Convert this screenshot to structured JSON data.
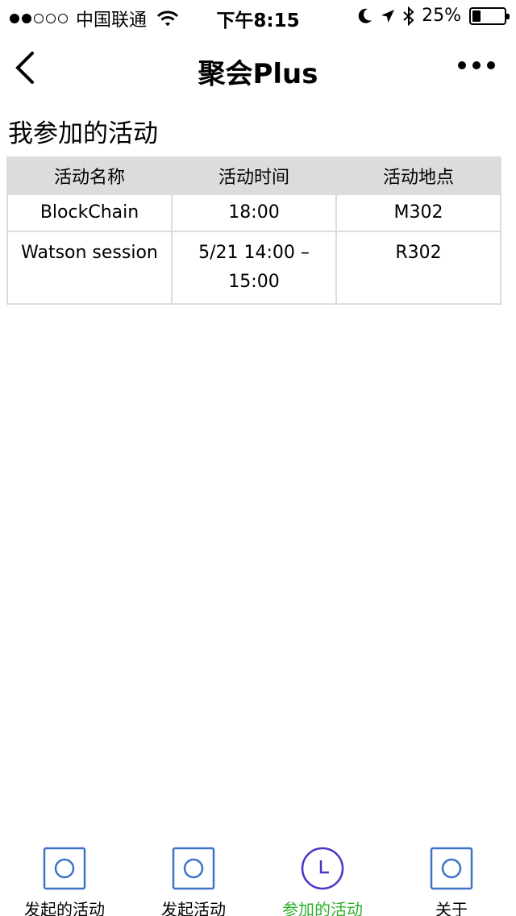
{
  "status_bar": {
    "carrier": "中国联通",
    "time": "下午8:15",
    "battery_percent": "25%",
    "battery_level": 0.25
  },
  "nav": {
    "title": "聚会Plus"
  },
  "page": {
    "section_title": "我参加的活动"
  },
  "table": {
    "headers": [
      "活动名称",
      "活动时间",
      "活动地点"
    ],
    "rows": [
      [
        "BlockChain",
        "18:00",
        "M302"
      ],
      [
        "Watson session",
        "5/21 14:00 – 15:00",
        "R302"
      ]
    ]
  },
  "tabs": [
    {
      "label": "发起的活动",
      "icon": "square-circle-icon",
      "active": false
    },
    {
      "label": "发起活动",
      "icon": "square-circle-icon",
      "active": false
    },
    {
      "label": "参加的活动",
      "icon": "clock-icon",
      "active": true
    },
    {
      "label": "关于",
      "icon": "square-circle-icon",
      "active": false
    }
  ],
  "colors": {
    "active_tab": "#2db12d",
    "icon_blue": "#3f73c9",
    "icon_purple": "#4b34c8",
    "table_header_bg": "#dcdcdc"
  }
}
